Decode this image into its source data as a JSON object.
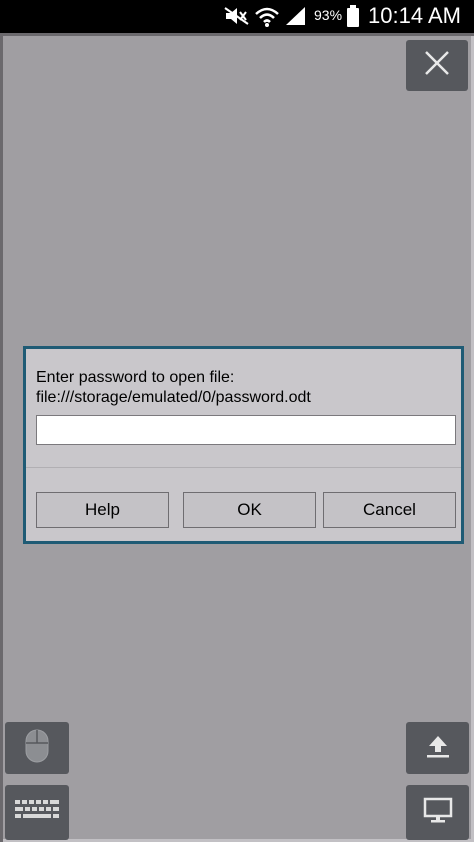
{
  "status_bar": {
    "battery_percent": "93%",
    "time": "10:14 AM",
    "icons": [
      "mute-icon",
      "wifi-icon",
      "signal-icon",
      "battery-icon"
    ]
  },
  "toolbar": {
    "close_icon": "close-icon",
    "mouse_icon": "mouse-icon",
    "keyboard_icon": "keyboard-icon",
    "upload_icon": "upload-icon",
    "display_icon": "display-icon"
  },
  "dialog": {
    "prompt": "Enter password to open file:",
    "file_path": "file:///storage/emulated/0/password.odt",
    "password_value": "",
    "buttons": {
      "help": "Help",
      "ok": "OK",
      "cancel": "Cancel"
    }
  },
  "colors": {
    "background": "#a09ea2",
    "dialog_border": "#1f5b75",
    "dialog_bg": "#c9c7cb",
    "tool_button": "#56585d"
  }
}
